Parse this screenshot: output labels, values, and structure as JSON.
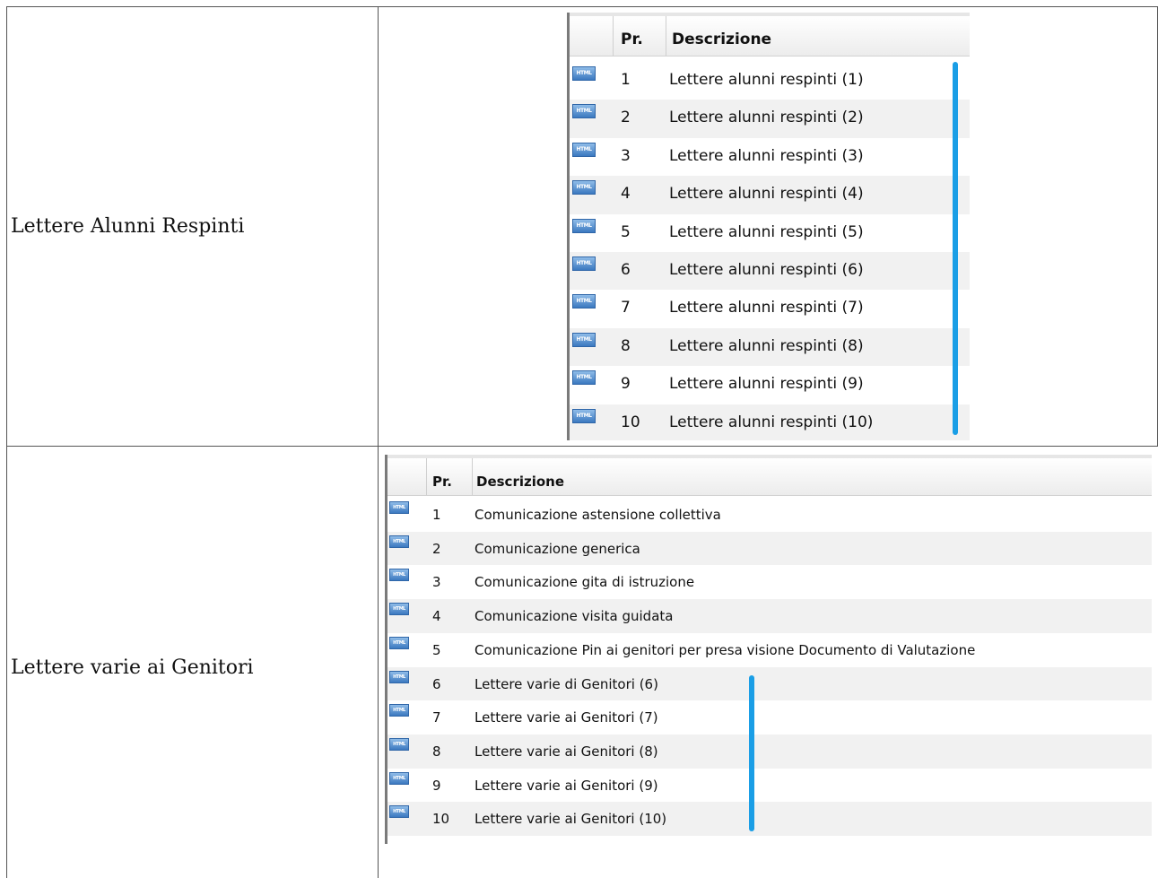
{
  "rows": [
    {
      "label": "Lettere Alunni Respinti",
      "grid": {
        "columns": {
          "number": "Pr.",
          "description": "Descrizione"
        },
        "items": [
          {
            "number": "1",
            "description": "Lettere alunni respinti (1)",
            "icon": "html-file-icon"
          },
          {
            "number": "2",
            "description": "Lettere alunni respinti (2)",
            "icon": "html-file-icon"
          },
          {
            "number": "3",
            "description": "Lettere alunni respinti (3)",
            "icon": "html-file-icon"
          },
          {
            "number": "4",
            "description": "Lettere alunni respinti (4)",
            "icon": "html-file-icon"
          },
          {
            "number": "5",
            "description": "Lettere alunni respinti (5)",
            "icon": "html-file-icon"
          },
          {
            "number": "6",
            "description": "Lettere alunni respinti (6)",
            "icon": "html-file-icon"
          },
          {
            "number": "7",
            "description": "Lettere alunni respinti (7)",
            "icon": "html-file-icon"
          },
          {
            "number": "8",
            "description": "Lettere alunni respinti (8)",
            "icon": "html-file-icon"
          },
          {
            "number": "9",
            "description": "Lettere alunni respinti (9)",
            "icon": "html-file-icon"
          },
          {
            "number": "10",
            "description": "Lettere alunni respinti (10)",
            "icon": "html-file-icon"
          }
        ]
      }
    },
    {
      "label": "Lettere varie ai Genitori",
      "grid": {
        "columns": {
          "number": "Pr.",
          "description": "Descrizione"
        },
        "items": [
          {
            "number": "1",
            "description": "Comunicazione astensione collettiva",
            "icon": "html-file-icon"
          },
          {
            "number": "2",
            "description": "Comunicazione generica",
            "icon": "html-file-icon"
          },
          {
            "number": "3",
            "description": "Comunicazione gita di istruzione",
            "icon": "html-file-icon"
          },
          {
            "number": "4",
            "description": "Comunicazione visita guidata",
            "icon": "html-file-icon"
          },
          {
            "number": "5",
            "description": "Comunicazione Pin ai genitori per presa visione Documento di Valutazione",
            "icon": "html-file-icon"
          },
          {
            "number": "6",
            "description": "Lettere varie di Genitori (6)",
            "icon": "html-file-icon"
          },
          {
            "number": "7",
            "description": "Lettere varie ai Genitori (7)",
            "icon": "html-file-icon"
          },
          {
            "number": "8",
            "description": "Lettere varie ai Genitori (8)",
            "icon": "html-file-icon"
          },
          {
            "number": "9",
            "description": "Lettere varie ai Genitori (9)",
            "icon": "html-file-icon"
          },
          {
            "number": "10",
            "description": "Lettere varie ai Genitori (10)",
            "icon": "html-file-icon"
          }
        ]
      }
    }
  ],
  "icon_text": "HTML",
  "colors": {
    "highlight_bar": "#1a9ee6",
    "icon": "#3b79c0",
    "alt_row": "#f1f1f1"
  }
}
